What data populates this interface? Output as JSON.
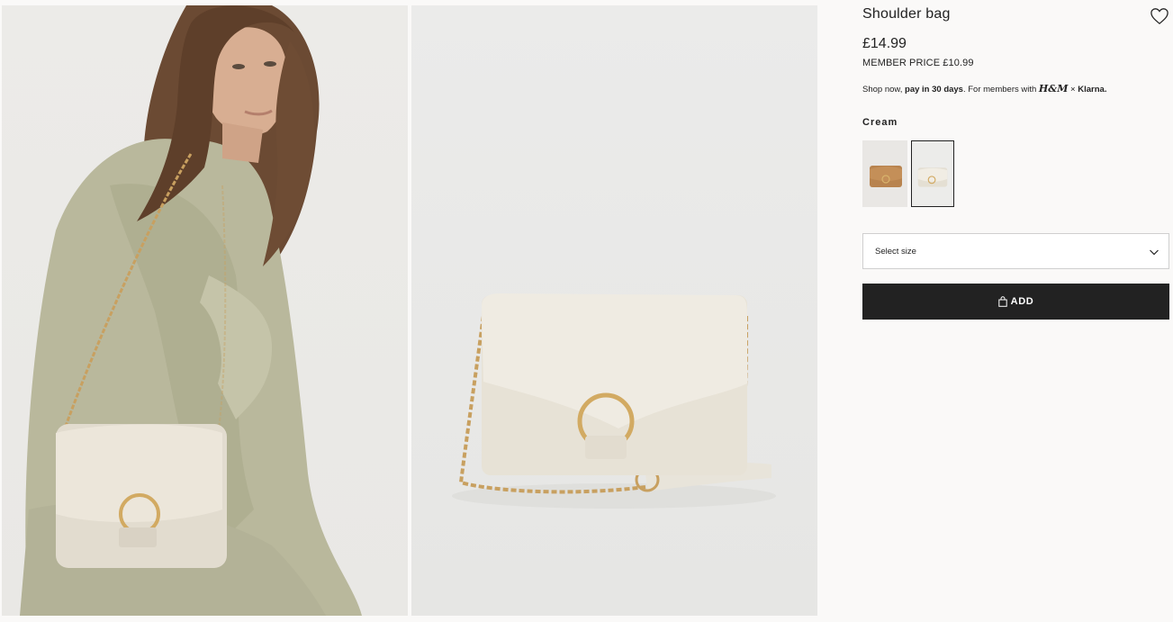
{
  "product": {
    "title": "Shoulder bag",
    "price": "£14.99",
    "member_price": "MEMBER PRICE £10.99",
    "klarna": {
      "prefix": "Shop now, ",
      "bold": "pay in 30 days",
      "middle": ". For members with ",
      "hm": "H&M",
      "times": " × ",
      "brand": "Klarna."
    },
    "color_label": "Cream",
    "swatches": [
      {
        "name": "Brown",
        "selected": false,
        "color": "#b8834e"
      },
      {
        "name": "Cream",
        "selected": true,
        "color": "#ece9e1"
      }
    ],
    "size_select": {
      "placeholder": "Select size"
    },
    "add_button": {
      "label": "ADD",
      "icon": "shopping-bag-icon"
    }
  },
  "icons": {
    "favorite": "heart-outline-icon",
    "dropdown": "chevron-down-icon"
  },
  "colors": {
    "button_bg": "#222222",
    "page_bg": "#faf9f8",
    "bag_cream": "#ece9e1",
    "chain_gold": "#c8a060",
    "blouse": "#b9b89c"
  }
}
